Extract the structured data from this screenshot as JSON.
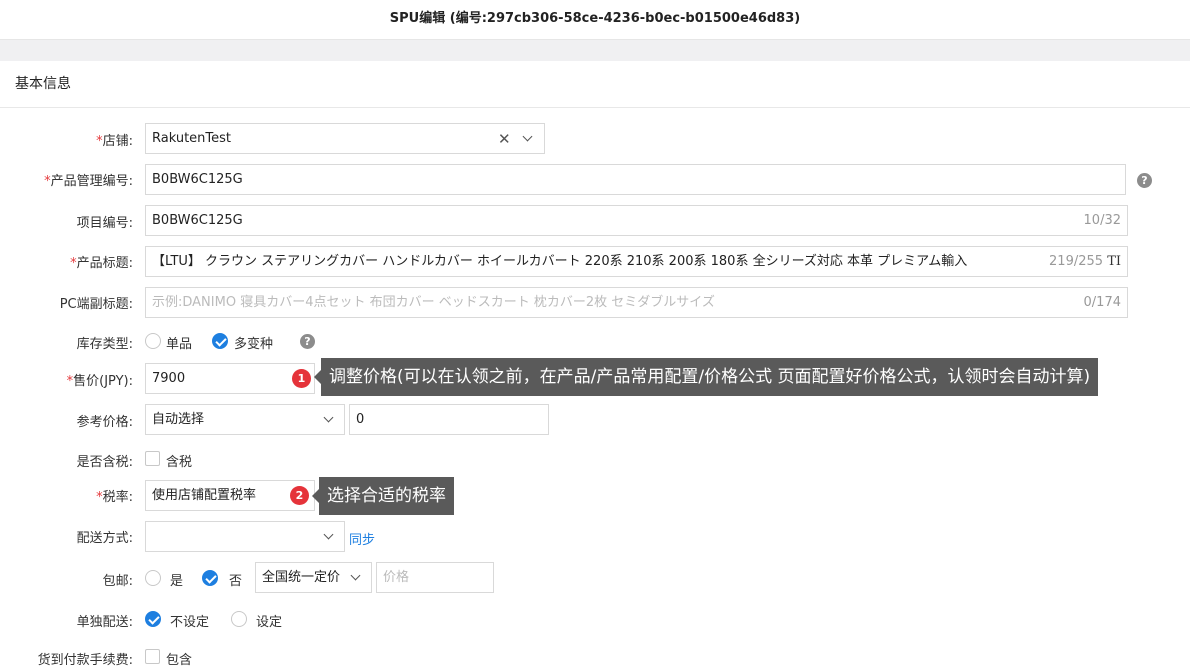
{
  "window_title": "SPU编辑 (编号:297cb306-58ce-4236-b0ec-b01500e46d83)",
  "section_title": "基本信息",
  "form": {
    "shop": {
      "label": "店铺:",
      "value": "RakutenTest"
    },
    "product_code": {
      "label": "产品管理编号:",
      "value": "B0BW6C125G"
    },
    "item_code": {
      "label": "项目编号:",
      "value": "B0BW6C125G",
      "count": "10/32"
    },
    "product_title": {
      "label": "产品标题:",
      "value": "【LTU】 クラウン ステアリングカバー ハンドルカバー ホイールカバート 220系 210系 200系 180系 全シリーズ対応 本革 プレミアム輸入",
      "count": "219/255",
      "extra": "TI"
    },
    "pc_subtitle": {
      "label": "PC端副标题:",
      "placeholder": "示例:DANIMO 寝具カバー4点セット 布団カバー ベッドスカート 枕カバー2枚 セミダブルサイズ",
      "count": "0/174"
    },
    "stock_type": {
      "label": "库存类型:",
      "options": [
        "单品",
        "多变种"
      ],
      "selected": "多变种"
    },
    "price": {
      "label": "售价(JPY):",
      "value": "7900"
    },
    "ref_price": {
      "label": "参考价格:",
      "select": "自动选择",
      "value": "0"
    },
    "tax_included": {
      "label": "是否含税:",
      "option": "含税",
      "checked": false
    },
    "tax_rate": {
      "label": "税率:",
      "value": "使用店铺配置税率"
    },
    "shipping": {
      "label": "配送方式:",
      "value": "",
      "sync": "同步"
    },
    "free_shipping": {
      "label": "包邮:",
      "options": [
        "是",
        "否"
      ],
      "selected": "否",
      "select": "全国统一定价",
      "price_placeholder": "价格"
    },
    "separate_shipping": {
      "label": "单独配送:",
      "options": [
        "不设定",
        "设定"
      ],
      "selected": "不设定"
    },
    "cod_fee": {
      "label": "货到付款手续费:",
      "option": "包含",
      "checked": false
    }
  },
  "annotations": [
    {
      "number": "1",
      "text": "调整价格(可以在认领之前，在产品/产品常用配置/价格公式 页面配置好价格公式，认领时会自动计算)"
    },
    {
      "number": "2",
      "text": "选择合适的税率"
    }
  ],
  "icons": {
    "help": "question-circle-icon",
    "clear": "clear-icon",
    "dropdown": "chevron-down-icon"
  },
  "colors": {
    "accent": "#1e7fe0",
    "required": "#e4393c",
    "badge": "#e5333a",
    "tooltip_bg": "#5a5a5a"
  }
}
